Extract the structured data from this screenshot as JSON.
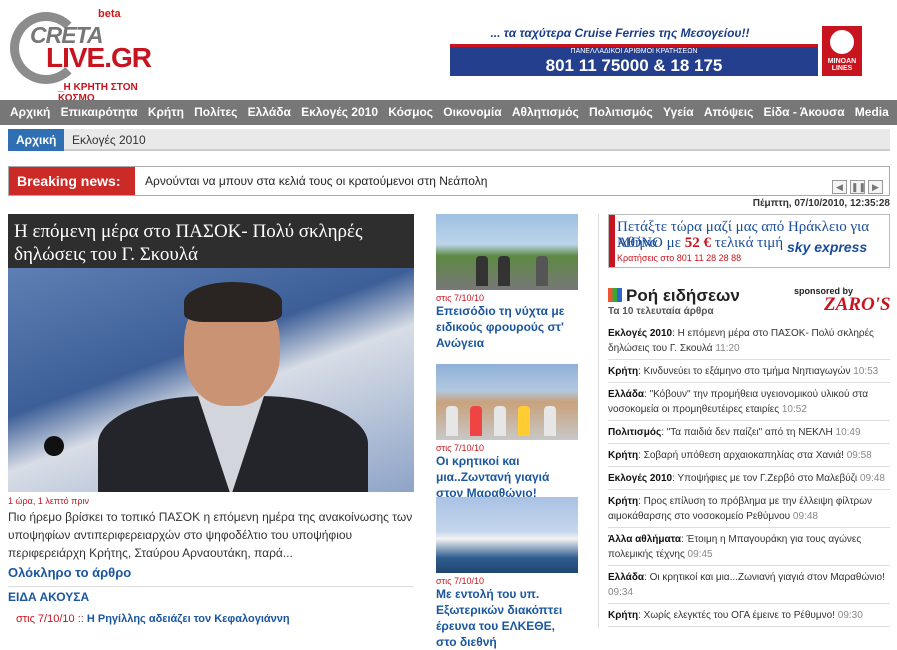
{
  "logo": {
    "beta": "beta",
    "line1": "CRETA",
    "line2": "LIVE.GR",
    "tagline": "_Η ΚΡΗΤΗ ΣΤΟΝ ΚΟΣΜΟ"
  },
  "ad_top": {
    "slogan": "... τα ταχύτερα Cruise Ferries της Μεσογείου!!",
    "small": "ΠΑΝΕΛΛΑΔΙΚΟΙ ΑΡΙΘΜΟΙ ΚΡΑΤΗΣΕΩΝ",
    "phones": "801 11 75000   & 18 175",
    "brand": "MINOAN LINES"
  },
  "nav": [
    "Αρχική",
    "Επικαιρότητα",
    "Κρήτη",
    "Πολίτες",
    "Ελλάδα",
    "Εκλογές 2010",
    "Κόσμος",
    "Οικονομία",
    "Αθλητισμός",
    "Πολιτισμός",
    "Υγεία",
    "Απόψεις",
    "Είδα - Άκουσα",
    "Media"
  ],
  "breadcrumb": {
    "home": "Αρχική",
    "current": "Εκλογές 2010"
  },
  "breaking": {
    "label": "Breaking news:",
    "text": "Αρνούνται να μπουν στα κελιά τους οι κρατούμενοι στη Νεάπολη"
  },
  "controls": {
    "prev": "◀",
    "pause": "❚❚",
    "next": "▶"
  },
  "datetime": "Πέμπτη, 07/10/2010, 12:35:28",
  "main_story": {
    "title": "Η επόμενη μέρα στο ΠΑΣΟΚ- Πολύ σκληρές δηλώσεις του Γ. Σκουλά",
    "meta": "1 ώρα, 1 λεπτό πριν",
    "summary": "Πιο ήρεμο βρίσκει το τοπικό ΠΑΣΟΚ η επόμενη ημέρα της ανακοίνωσης των υποψηφίων αντιπεριφερειαρχών στο ψηφοδέλτιο του υποψήφιου περιφερειάρχη Κρήτης, Σταύρου Αρναουτάκη, παρά...",
    "more": "Ολόκληρο το άρθρο"
  },
  "eida": {
    "heading": "ΕΙΔΑ ΑΚΟΥΣΑ",
    "date": "στις 7/10/10 ::",
    "title": " Η Ρηγίλλης αδειάζει τον Κεφαλογιάννη"
  },
  "side_stories": [
    {
      "date": "στις 7/10/10",
      "title": "Επεισόδιο τη νύχτα με ειδικούς φρουρούς στ' Ανώγεια"
    },
    {
      "date": "στις 7/10/10",
      "title": "Οι κρητικοί και μια..Ζωντανή γιαγιά στον Μαραθώνιο!"
    },
    {
      "date": "στις 7/10/10",
      "title": "Με εντολή του υπ. Εξωτερικών διακόπτει έρευνα του ΕΛΚΕΘΕ, στο διεθνή"
    }
  ],
  "ad_sky": {
    "line1": "Πετάξτε τώρα μαζί μας από Ηράκλειο για Αθήνα",
    "line2a": "ΜΟΝΟ με ",
    "price": "52 €",
    "line2b": " τελικά τιμή",
    "line3": "Κρατήσεις στο 801 11 28 28 88",
    "logo": "sky express"
  },
  "feed": {
    "title": "Ροή ειδήσεων",
    "subtitle": "Τα 10 τελευταία άρθρα",
    "sponsored": "sponsored by",
    "sponsor": "ZARO'S",
    "items": [
      {
        "cat": "Εκλογές 2010",
        "text": ": Η επόμενη μέρα στο ΠΑΣΟΚ- Πολύ σκληρές δηλώσεις του Γ. Σκουλά ",
        "time": "11:20"
      },
      {
        "cat": "Κρήτη",
        "text": ": Κινδυνεύει το εξάμηνο στο τμήμα Νηπιαγωγών ",
        "time": "10:53"
      },
      {
        "cat": "Ελλάδα",
        "text": ": \"Κόβουν\" την προμήθεια υγειονομικού υλικού στα νοσοκομεία οι προμηθευτέιρες εταιρίες ",
        "time": "10:52"
      },
      {
        "cat": "Πολιτισμός",
        "text": ": \"Τα παιδιά δεν παίζει\" από τη ΝΕΚΛΗ ",
        "time": "10:49"
      },
      {
        "cat": "Κρήτη",
        "text": ": Σοβαρή υπόθεση αρχαιοκαπηλίας στα Χανιά! ",
        "time": "09:58"
      },
      {
        "cat": "Εκλογές 2010",
        "text": ": Υποψήφιες με τον Γ.Ζερβό στο Μαλεβύζι ",
        "time": "09:48"
      },
      {
        "cat": "Κρήτη",
        "text": ": Προς επίλυση το πρόβλημα με την έλλειψη φίλτρων αιμοκάθαρσης στο νοσοκομείο Ρεθύμνου ",
        "time": "09:48"
      },
      {
        "cat": "Άλλα αθλήματα",
        "text": ": Έτοιμη η Μπαγουράκη για τους αγώνες πολεμικής τέχνης ",
        "time": "09:45"
      },
      {
        "cat": "Ελλάδα",
        "text": ": Οι κρητικοί και μια...Ζωνιανή γιαγιά στον Μαραθώνιο! ",
        "time": "09:34"
      },
      {
        "cat": "Κρήτη",
        "text": ": Χωρίς ελεγκτές του ΟΓΑ έμεινε το Ρέθυμνο! ",
        "time": "09:30"
      }
    ]
  }
}
